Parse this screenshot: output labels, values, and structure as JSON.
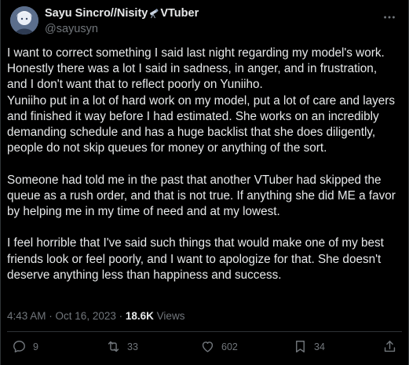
{
  "author": {
    "display_name_part1": "Sayu Sincro//Nisity",
    "display_name_part2": "VTuber",
    "name_emoji_icon": "telescope-icon",
    "handle": "@sayusyn"
  },
  "tweet": {
    "lines": [
      "I want to correct something I said last night regarding my model's work.",
      "Honestly there was a lot I said in sadness, in anger, and in frustration,",
      "and I don't want that to reflect poorly on Yuniiho.",
      "Yuniiho put in a lot of hard work on my model, put a lot of care and layers",
      "and finished it way before I had estimated. She works on an incredibly",
      "demanding schedule and has a huge backlist that she does diligently,",
      "people do not skip queues for money or anything of the sort.",
      "",
      "Someone had told me in the past that another VTuber had skipped the",
      "queue as a rush order, and that is not true. If anything she did ME a favor",
      "by helping me in my time of need and at my lowest.",
      "",
      "I feel horrible that I've said such things that would make one of my best",
      "friends look or feel poorly, and I want to apologize for that. She doesn't",
      "deserve anything less than happiness and success."
    ],
    "time": "4:43 AM",
    "separator": "·",
    "date": "Oct 16, 2023",
    "views_count": "18.6K",
    "views_label": "Views"
  },
  "actions": {
    "replies": "9",
    "retweets": "33",
    "likes": "602",
    "bookmarks": "34"
  },
  "colors": {
    "background": "#000000",
    "text": "#e7e9ea",
    "muted": "#71767b",
    "border": "#2f3336"
  }
}
